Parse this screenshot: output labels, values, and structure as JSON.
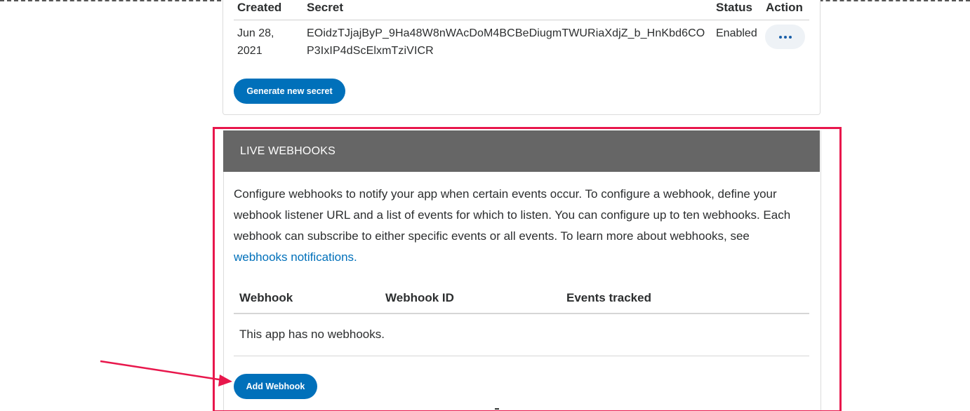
{
  "secrets": {
    "headers": {
      "created": "Created",
      "secret": "Secret",
      "status": "Status",
      "action": "Action"
    },
    "row": {
      "created": "Jun 28, 2021",
      "secret": "EOidzTJjajByP_9Ha48W8nWAcDoM4BCBeDiugmTWURiaXdjZ_b_HnKbd6COP3IxIP4dScElxmTziVICR",
      "status": "Enabled",
      "action_icon": "more-dots-icon"
    },
    "generate_button": "Generate new secret"
  },
  "webhooks": {
    "title": "LIVE WEBHOOKS",
    "description": "Configure webhooks to notify your app when certain events occur. To configure a webhook, define your webhook listener URL and a list of events for which to listen. You can configure up to ten webhooks. Each webhook can subscribe to either specific events or all events. To learn more about webhooks, see",
    "link_text": "webhooks notifications.",
    "columns": {
      "webhook": "Webhook",
      "webhook_id": "Webhook ID",
      "events": "Events tracked"
    },
    "empty_message": "This app has no webhooks.",
    "add_button": "Add Webhook"
  },
  "colors": {
    "primary": "#0070ba",
    "header_bg": "#666666",
    "annotation": "#e8174c"
  }
}
